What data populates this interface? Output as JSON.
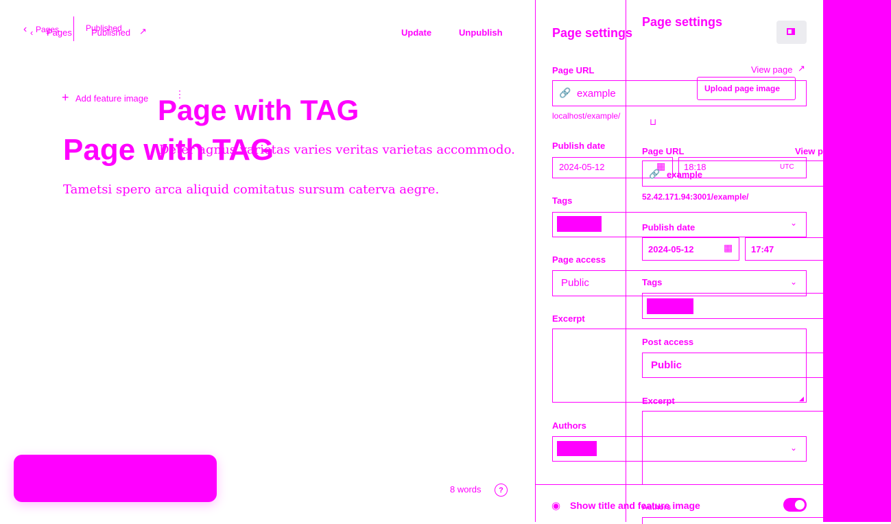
{
  "topbar": {
    "back_label": "Pages",
    "status_label": "Published",
    "update_label": "Update",
    "unpublish_label": "Unpublish",
    "ghost_back_label": "Pages",
    "ghost_status_label": "Published"
  },
  "editor": {
    "add_feature_image_label": "Add feature image",
    "title": "Page with TAG",
    "ghost_title": "Page with TAG",
    "body_text_1": "Deter agnus varietas varies veritas varietas accommodo.",
    "body_text_2": "Tametsi spero arca aliquid comitatus sursum caterva aegre.",
    "word_count": "8 words"
  },
  "settings": {
    "title": "Page settings",
    "page_url_label": "Page URL",
    "view_page_label": "View page",
    "slug_value": "example",
    "url_preview": "localhost/example/",
    "publish_date_label": "Publish date",
    "date_value": "2024-05-12",
    "time_value": "18:18",
    "timezone": "UTC",
    "tags_label": "Tags",
    "page_access_label": "Page access",
    "page_access_value": "Public",
    "excerpt_label": "Excerpt",
    "authors_label": "Authors",
    "show_title_label": "Show title and feature image"
  },
  "overlay": {
    "title": "Page settings",
    "upload_image_label": "Upload page image",
    "page_url_label": "Page URL",
    "view_page_label": "View p",
    "slug_value": "example",
    "url_preview": "52.42.171.94:3001/example/",
    "publish_date_label": "Publish date",
    "date_value": "2024-05-12",
    "time_value": "17:47",
    "tags_label": "Tags",
    "post_access_label": "Post access",
    "post_access_value": "Public",
    "excerpt_label": "Excerpt",
    "authors_label": "Authors"
  },
  "colors": {
    "accent": "#ff00ff",
    "background": "#ffffff",
    "button_bg": "#ececf0"
  }
}
